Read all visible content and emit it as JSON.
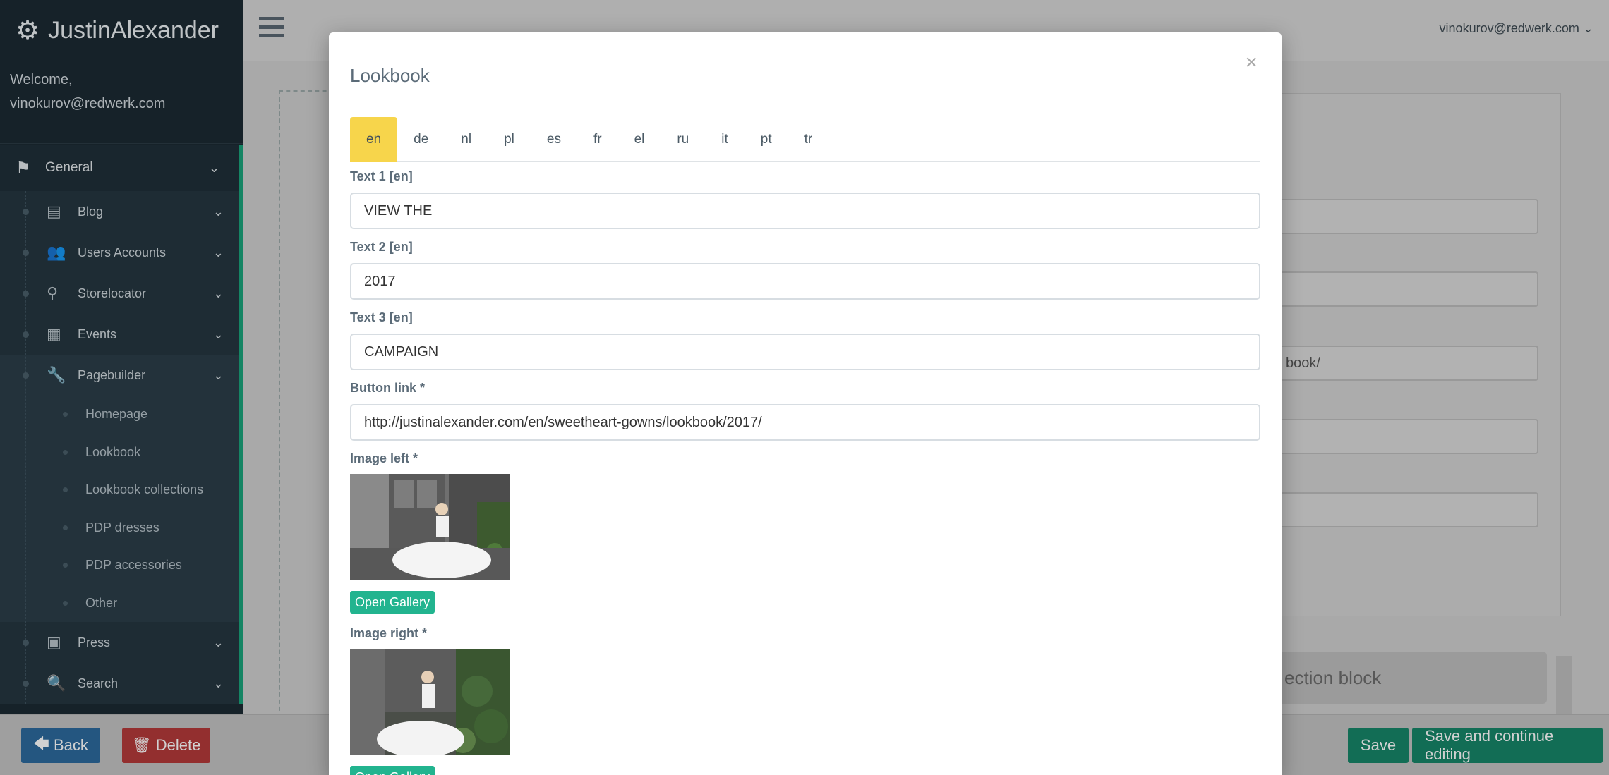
{
  "sidebar": {
    "brand": "JustinAlexander",
    "welcome_line1": "Welcome,",
    "welcome_line2": "vinokurov@redwerk.com",
    "general_label": "General",
    "items": [
      {
        "label": "Blog",
        "icon": "book-icon"
      },
      {
        "label": "Users Accounts",
        "icon": "users-icon"
      },
      {
        "label": "Storelocator",
        "icon": "map-marker-icon"
      },
      {
        "label": "Events",
        "icon": "calendar-icon"
      },
      {
        "label": "Pagebuilder",
        "icon": "wrench-icon"
      }
    ],
    "pagebuilder_children": [
      "Homepage",
      "Lookbook",
      "Lookbook collections",
      "PDP dresses",
      "PDP accessories",
      "Other"
    ],
    "bottom_items": [
      {
        "label": "Press",
        "icon": "newspaper-icon"
      },
      {
        "label": "Search",
        "icon": "search-icon"
      }
    ]
  },
  "topbar": {
    "user_email": "vinokurov@redwerk.com"
  },
  "background": {
    "input_value": "book/",
    "block_text": "ection block"
  },
  "footer": {
    "back_label": "Back",
    "delete_label": "Delete",
    "save_label": "Save",
    "save_continue_label": "Save and continue editing"
  },
  "modal": {
    "title": "Lookbook",
    "close_symbol": "×",
    "tabs": [
      "en",
      "de",
      "nl",
      "pl",
      "es",
      "fr",
      "el",
      "ru",
      "it",
      "pt",
      "tr"
    ],
    "active_tab": "en",
    "text1_label": "Text 1 [en]",
    "text1_value": "VIEW THE",
    "text2_label": "Text 2 [en]",
    "text2_value": "2017",
    "text3_label": "Text 3 [en]",
    "text3_value": "CAMPAIGN",
    "button_link_label": "Button link *",
    "button_link_value": "http://justinalexander.com/en/sweetheart-gowns/lookbook/2017/",
    "image_left_label": "Image left *",
    "image_right_label": "Image right *",
    "open_gallery_label": "Open Gallery"
  },
  "colors": {
    "sidebar_bg": "#1b2a33",
    "accent_green": "#1aa37a",
    "active_tab": "#f7d54b",
    "gallery_button": "#22b48f",
    "back_button": "#2d6a9d",
    "delete_button": "#b43a3a",
    "save_button": "#168568"
  }
}
